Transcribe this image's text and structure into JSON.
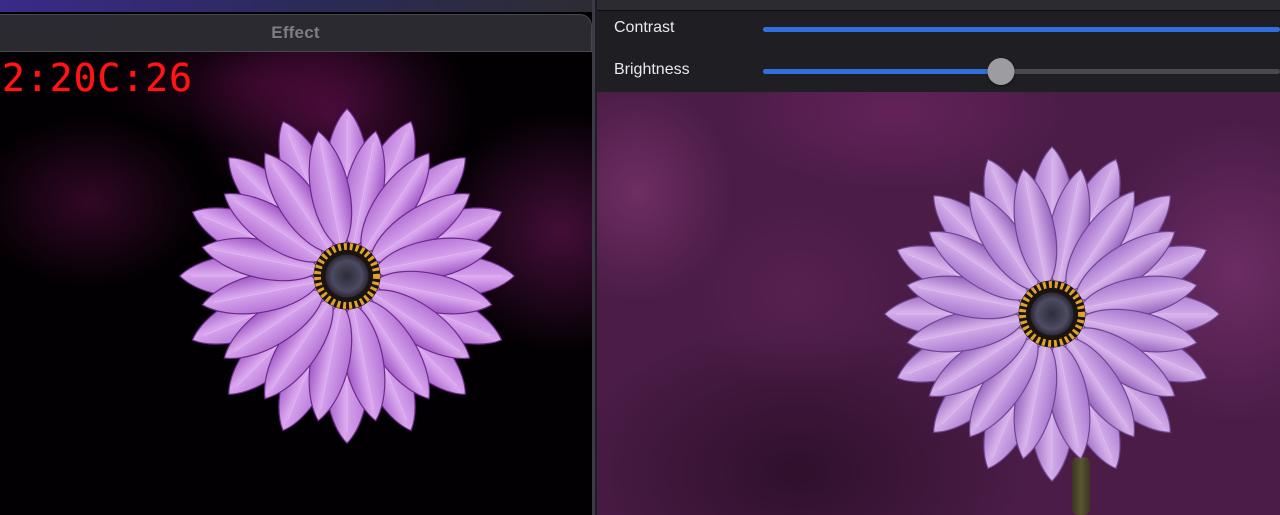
{
  "effect_window": {
    "title": "Effect",
    "timestamp_overlay": "2:20C:26",
    "image": {
      "subject": "purple daisy flower",
      "variant": "effect-applied"
    }
  },
  "adjust_panel": {
    "sliders": [
      {
        "label": "Contrast",
        "value": 1.0
      },
      {
        "label": "Brightness",
        "value": 0.46
      }
    ],
    "accent_color": "#2f6fde",
    "image": {
      "subject": "purple daisy flower",
      "variant": "original"
    }
  },
  "icons": {
    "thumb": "slider-thumb"
  }
}
